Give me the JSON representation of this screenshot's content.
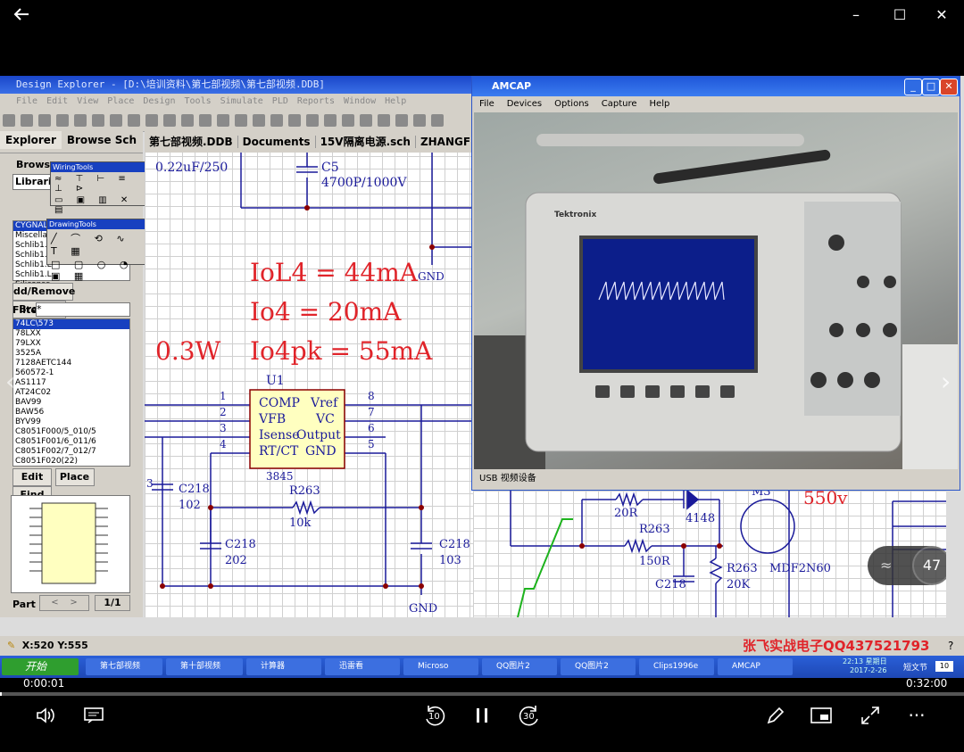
{
  "player": {
    "back_icon": "arrow-left-icon",
    "time_current": "0:00:01",
    "time_total": "0:32:00",
    "volume_icon": "speaker-icon",
    "subtitles_icon": "captions-icon",
    "rewind_label": "10",
    "forward_label": "30",
    "pause_icon": "pause-icon",
    "edit_icon": "pencil-icon",
    "miniview_icon": "mini-view-icon",
    "fullscreen_icon": "expand-icon",
    "more_label": "···"
  },
  "design_explorer": {
    "title": "Design Explorer - [D:\\培训资料\\第七部视频\\第七部视频.DDB]",
    "menu": [
      "File",
      "Edit",
      "View",
      "Place",
      "Design",
      "Tools",
      "Simulate",
      "PLD",
      "Reports",
      "Window",
      "Help"
    ],
    "left_tabs": [
      "Explorer",
      "Browse Sch"
    ],
    "browse_label": "Brows",
    "libraries_label": "Librari",
    "wiring_tools_title": "WiringTools",
    "drawing_tools_title": "DrawingTools",
    "libraries": [
      "CYGNAL",
      "Miscellaneous Devices.lib",
      "Schlib1.L",
      "Schlib1.L",
      "Schlib1.L",
      "Schlib1.L",
      "Siliconsc"
    ],
    "add_remove": "dd/Remove",
    "browse_button": "Browse",
    "filter_label": "Filte",
    "filter_value": "*",
    "components": [
      "74LC\\573",
      "78LXX",
      "79LXX",
      "3525A",
      "7128AETC144",
      "560572-1",
      "AS1117",
      "AT24C02",
      "BAV99",
      "BAW56",
      "BYV99",
      "C8051F000/5_010/5",
      "C8051F001/6_011/6",
      "C8051F002/7_012/7",
      "C8051F020(22)"
    ],
    "edit_button": "Edit",
    "place_button": "Place",
    "find_button": "Find",
    "part_label": "Part",
    "part_page": "1/1",
    "doc_tabs": [
      "第七部视频.DDB",
      "Documents",
      "15V隔离电源.sch",
      "ZHANGFEI"
    ],
    "status_coords": "X:520 Y:555",
    "watermark": "张飞实战电子QQ437521793"
  },
  "schematic": {
    "cap_top_left": "0.22uF/250",
    "c5_label": "C5",
    "c5_value": "4700P/1000V",
    "gnd1": "GND",
    "formula1": "IoL4 = 44mA",
    "formula2": "Io4 = 20mA",
    "formula3": "Io4pk = 55mA",
    "power": "0.3W",
    "u1": "U1",
    "ic_rows": [
      {
        "left": "COMP",
        "right": "Vref",
        "pin_l": "1",
        "pin_r": "8"
      },
      {
        "left": "VFB",
        "right": "VC",
        "pin_l": "2",
        "pin_r": "7"
      },
      {
        "left": "Isense",
        "right": "Output",
        "pin_l": "3",
        "pin_r": "6"
      },
      {
        "left": "RT/CT",
        "right": "GND",
        "pin_l": "4",
        "pin_r": "5"
      }
    ],
    "ic_part": "3845",
    "c218a": "C218",
    "c218a_v": "102",
    "r263a": "R263",
    "r263a_v": "10k",
    "c218b": "C218",
    "c218b_v": "202",
    "c218c": "C218",
    "c218c_v": "103",
    "side3": "3",
    "gnd2": "GND",
    "r20": "20R",
    "d4148": "4148",
    "m3": "M3",
    "v550": "550v",
    "r263b": "R263",
    "r263b_v": "150R",
    "r263c": "R263",
    "r263c_v": "20K",
    "c218d": "C218",
    "mosfet": "MDF2N60",
    "zoom_percent": "47"
  },
  "amcap": {
    "title": "AMCAP",
    "menu": [
      "File",
      "Devices",
      "Options",
      "Capture",
      "Help"
    ],
    "scope_brand": "Tektronix",
    "status": "USB 视频设备"
  },
  "taskbar": {
    "start": "开始",
    "items": [
      "第七部视频",
      "第十部视频",
      "计算器",
      "迅雷看",
      "Microso",
      "QQ图片2",
      "QQ图片2",
      "Clips1996e",
      "AMCAP"
    ],
    "clock_time": "22:13 星期日",
    "clock_date": "2017-2-26",
    "ime": "短文节",
    "ime_num": "10"
  },
  "colors": {
    "accent_red": "#e0242a",
    "wire_blue": "#1a1a9a",
    "titlebar": "#1a46c9"
  }
}
